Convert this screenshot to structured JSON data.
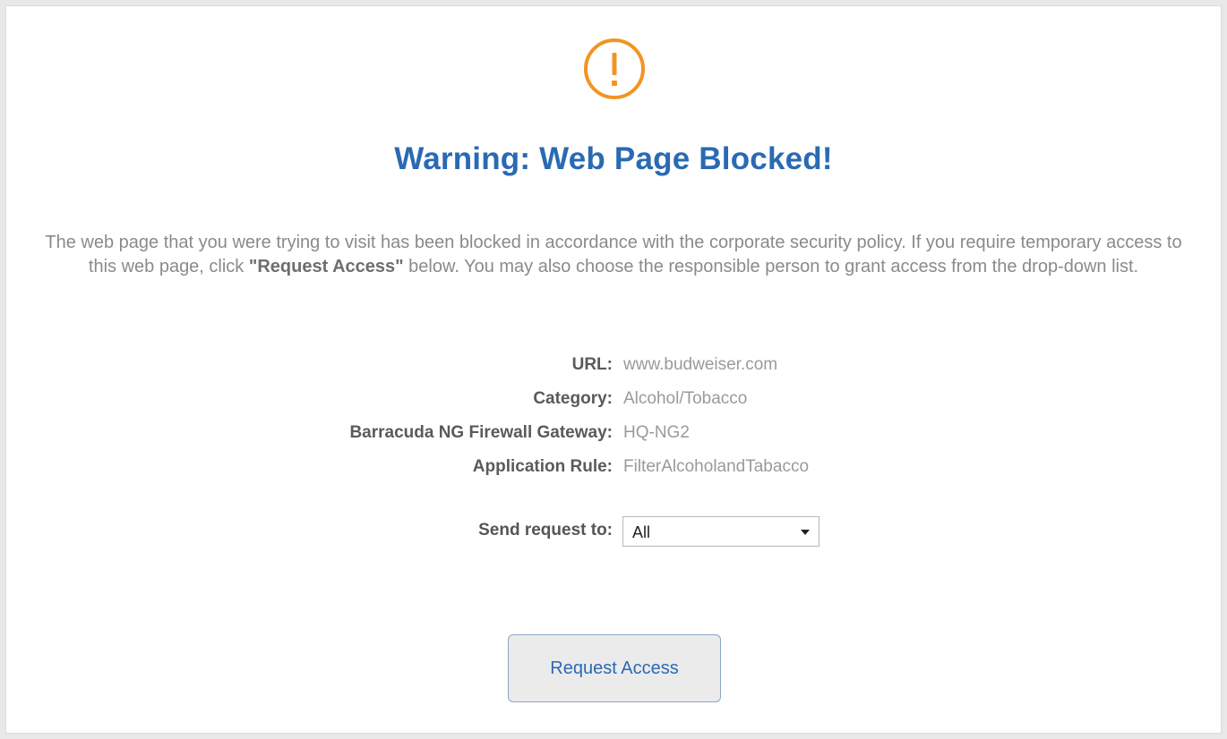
{
  "header": {
    "icon": "exclamation-circle-icon",
    "icon_color": "#f29423",
    "title": "Warning: Web Page Blocked!",
    "title_color": "#2a6ab3"
  },
  "message": {
    "part1": "The web page that you were trying to visit has been blocked in accordance with the corporate security policy. If you require temporary access to this web page, click ",
    "emphasis": "\"Request Access\"",
    "part2": " below. You may also choose the responsible person to grant access from the drop-down list."
  },
  "details": [
    {
      "label": "URL:",
      "value": "www.budweiser.com"
    },
    {
      "label": "Category:",
      "value": "Alcohol/Tobacco"
    },
    {
      "label": "Barracuda NG Firewall Gateway:",
      "value": "HQ-NG2"
    },
    {
      "label": "Application Rule:",
      "value": "FilterAlcoholandTabacco"
    }
  ],
  "request": {
    "send_label": "Send request to:",
    "recipient_selected": "All",
    "button_label": "Request Access"
  }
}
